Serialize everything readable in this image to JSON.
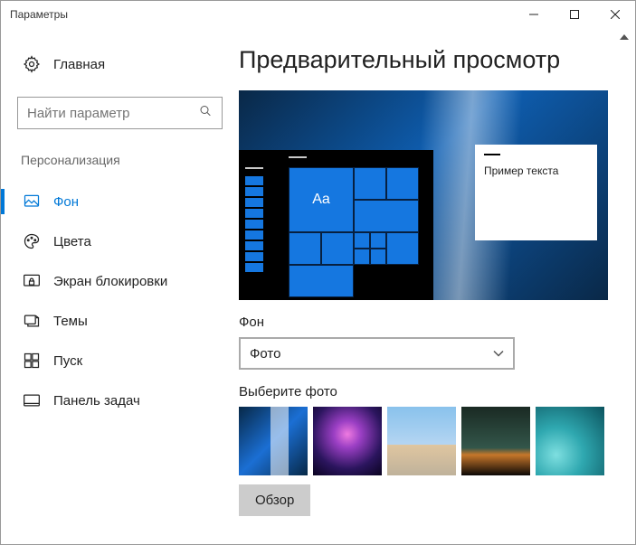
{
  "titlebar": {
    "title": "Параметры"
  },
  "sidebar": {
    "home": "Главная",
    "search_placeholder": "Найти параметр",
    "section": "Персонализация",
    "items": [
      {
        "label": "Фон"
      },
      {
        "label": "Цвета"
      },
      {
        "label": "Экран блокировки"
      },
      {
        "label": "Темы"
      },
      {
        "label": "Пуск"
      },
      {
        "label": "Панель задач"
      }
    ]
  },
  "main": {
    "heading": "Предварительный просмотр",
    "preview_sample": "Пример текста",
    "preview_aa": "Aa",
    "bg_label": "Фон",
    "bg_select": "Фото",
    "choose_label": "Выберите фото",
    "browse": "Обзор"
  }
}
